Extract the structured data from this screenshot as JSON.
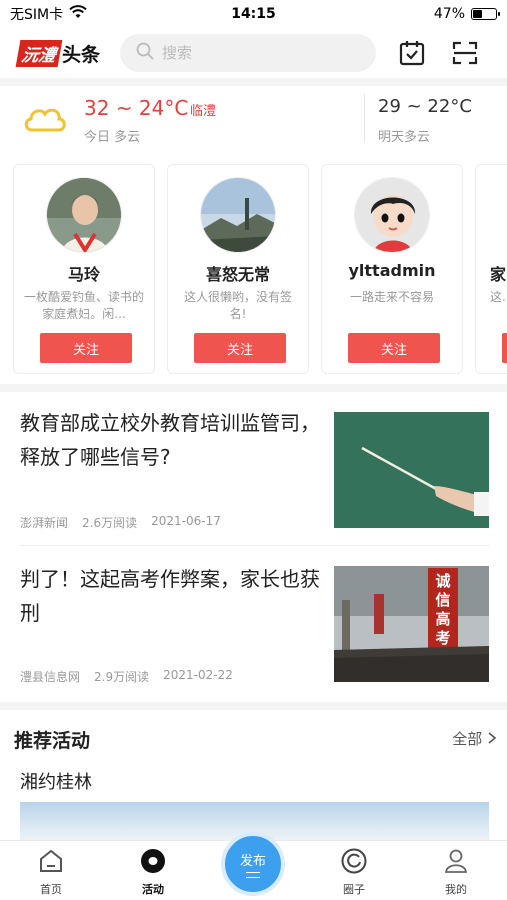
{
  "status_bar": {
    "carrier": "无SIM卡",
    "time": "14:15",
    "battery_percent": "47%",
    "battery_level": 0.47
  },
  "header": {
    "logo_red": "沅澧",
    "logo_black": "头条",
    "search_placeholder": "搜索",
    "icons": [
      "calendar-check-icon",
      "scan-icon"
    ]
  },
  "weather": {
    "today_temp": "32 ~ 24°C",
    "city": "临澧",
    "today_desc": "今日 多云",
    "tomorrow_temp": "29 ~ 22°C",
    "tomorrow_desc": "明天多云"
  },
  "users": [
    {
      "name": "马玲",
      "bio": "一枚酷爱钓鱼、读书的家庭煮妇。闲...",
      "follow": "关注"
    },
    {
      "name": "喜怒无常",
      "bio": "这人很懒哟，没有签名!",
      "follow": "关注"
    },
    {
      "name": "ylttadmin",
      "bio": "一路走来不容易",
      "follow": "关注"
    },
    {
      "name": "家",
      "bio": "这...",
      "follow": "关注"
    }
  ],
  "news": [
    {
      "title": "教育部成立校外教育培训监管司，释放了哪些信号?",
      "source": "澎湃新闻",
      "reads": "2.6万阅读",
      "date": "2021-06-17"
    },
    {
      "title": "判了！这起高考作弊案，家长也获刑",
      "source": "澧县信息网",
      "reads": "2.9万阅读",
      "date": "2021-02-22"
    }
  ],
  "news_thumb2_sign": "诚信高考",
  "activities": {
    "title": "推荐活动",
    "all_label": "全部",
    "item_name": "湘约桂林"
  },
  "tabbar": {
    "home": "首页",
    "activity": "活动",
    "publish": "发布",
    "circle": "圈子",
    "mine": "我的"
  }
}
